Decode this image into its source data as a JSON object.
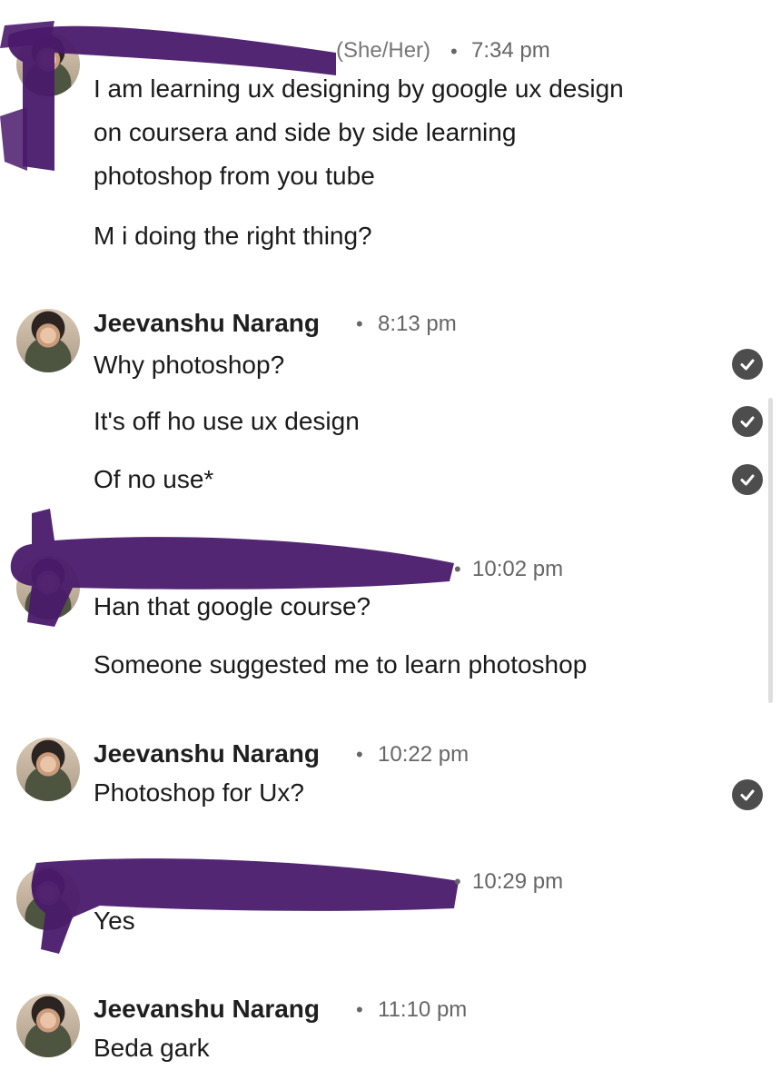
{
  "messages": [
    {
      "sender_visible": "(She/Her)",
      "time": "7:34 pm",
      "lines": [
        "I am learning ux designing by google ux design",
        "on coursera and side by side learning",
        "photoshop from you tube"
      ],
      "extra": "M i doing the right thing?"
    },
    {
      "sender": "Jeevanshu Narang",
      "time": "8:13 pm",
      "items": [
        "Why photoshop?",
        "It's off ho use  ux design",
        "Of no use*"
      ]
    },
    {
      "time": "10:02 pm",
      "items": [
        "Han that google course?",
        "Someone suggested me to learn photoshop"
      ]
    },
    {
      "sender": "Jeevanshu Narang",
      "time": "10:22 pm",
      "items": [
        "Photoshop for Ux?"
      ]
    },
    {
      "time": "10:29 pm",
      "items": [
        "Yes"
      ]
    },
    {
      "sender": "Jeevanshu Narang",
      "time": "11:10 pm",
      "items": [
        "Beda gark"
      ]
    }
  ],
  "separator": "•",
  "icons": {
    "read_receipt": "check-circle-icon"
  },
  "colors": {
    "redaction": "#4a1a6b",
    "check": "#4d4d4d",
    "meta": "#666666"
  }
}
